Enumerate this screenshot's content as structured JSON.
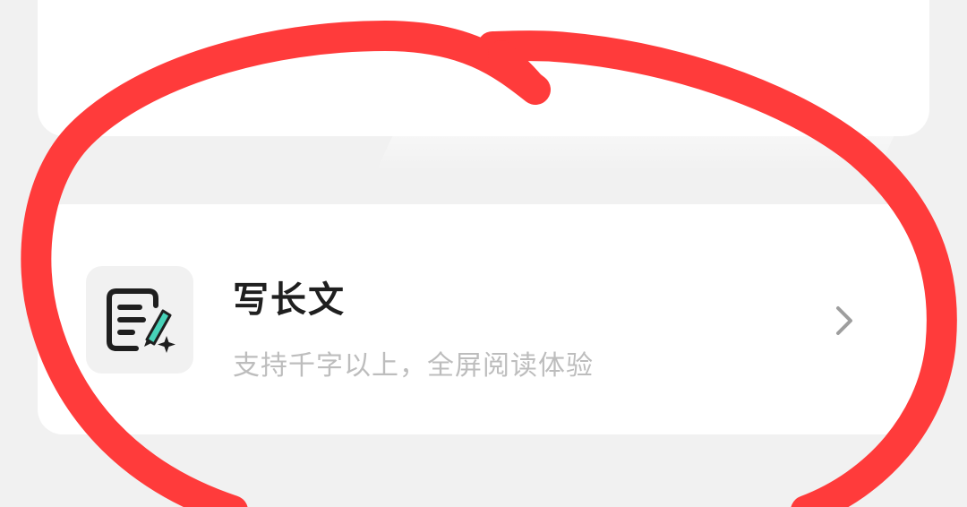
{
  "list_item": {
    "title": "写长文",
    "subtitle": "支持千字以上，全屏阅读体验",
    "icon": "long-article-edit-icon"
  },
  "colors": {
    "background": "#f1f1f1",
    "card": "#ffffff",
    "title": "#1f1f1f",
    "subtitle": "#bdbdbd",
    "accent": "#47d2b8",
    "annotation": "#ff3b3b"
  }
}
